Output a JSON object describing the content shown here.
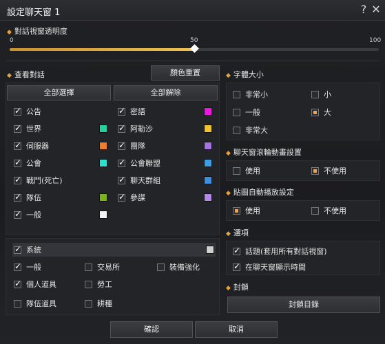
{
  "window": {
    "title": "設定聊天窗 1",
    "help_icon": "?",
    "close_icon": "✕"
  },
  "opacity": {
    "label": "對話視窗透明度",
    "min_label": "0",
    "mid_label": "50",
    "max_label": "100",
    "value": 50
  },
  "view_chat": {
    "label": "查看對話",
    "color_reset": "顏色重置",
    "select_all": "全部選擇",
    "deselect_all": "全部解除",
    "left_items": [
      {
        "label": "公告",
        "checked": true,
        "color": ""
      },
      {
        "label": "世界",
        "checked": true,
        "color": "#22d39a"
      },
      {
        "label": "伺服器",
        "checked": true,
        "color": "#f07d2a"
      },
      {
        "label": "公會",
        "checked": true,
        "color": "#2ee0cf"
      },
      {
        "label": "戰鬥(死亡)",
        "checked": true,
        "color": ""
      },
      {
        "label": "隊伍",
        "checked": true,
        "color": "#7cb31a"
      },
      {
        "label": "一般",
        "checked": true,
        "color": "#f2f2f2"
      }
    ],
    "right_items": [
      {
        "label": "密語",
        "checked": true,
        "color": "#ef16e4"
      },
      {
        "label": "阿勒沙",
        "checked": true,
        "color": "#f2c42a"
      },
      {
        "label": "團隊",
        "checked": true,
        "color": "#a574e0"
      },
      {
        "label": "公會聯盟",
        "checked": true,
        "color": "#3d9ee8"
      },
      {
        "label": "聊天群組",
        "checked": true,
        "color": "#3d8fe0"
      },
      {
        "label": "參謀",
        "checked": true,
        "color": "#b08ae6"
      }
    ]
  },
  "system": {
    "label": "系統",
    "checked": true,
    "color": "#d0d0d0",
    "items": [
      {
        "label": "一般",
        "checked": true
      },
      {
        "label": "交易所",
        "checked": false
      },
      {
        "label": "裝備強化",
        "checked": false
      },
      {
        "label": "個人道具",
        "checked": true
      },
      {
        "label": "勞工",
        "checked": false
      },
      {
        "label": "隊伍道具",
        "checked": false
      },
      {
        "label": "耕種",
        "checked": false
      }
    ]
  },
  "font_size": {
    "label": "字體大小",
    "options": [
      {
        "label": "非常小",
        "selected": false
      },
      {
        "label": "小",
        "selected": false
      },
      {
        "label": "一般",
        "selected": false
      },
      {
        "label": "大",
        "selected": true
      },
      {
        "label": "非常大",
        "selected": false
      }
    ]
  },
  "scroll_anim": {
    "label": "聊天窗滾輪動畫設置",
    "options": [
      {
        "label": "使用",
        "selected": false
      },
      {
        "label": "不使用",
        "selected": true
      }
    ]
  },
  "sticker_anim": {
    "label": "貼圖自動播放設定",
    "options": [
      {
        "label": "使用",
        "selected": true
      },
      {
        "label": "不使用",
        "selected": false
      }
    ]
  },
  "options": {
    "label": "選項",
    "items": [
      {
        "label": "話題(套用所有對話視窗)",
        "checked": true
      },
      {
        "label": "在聊天窗顯示時間",
        "checked": true
      }
    ]
  },
  "lock": {
    "label": "封鎖",
    "list_button": "封鎖目錄"
  },
  "footer": {
    "confirm": "確認",
    "cancel": "取消"
  }
}
